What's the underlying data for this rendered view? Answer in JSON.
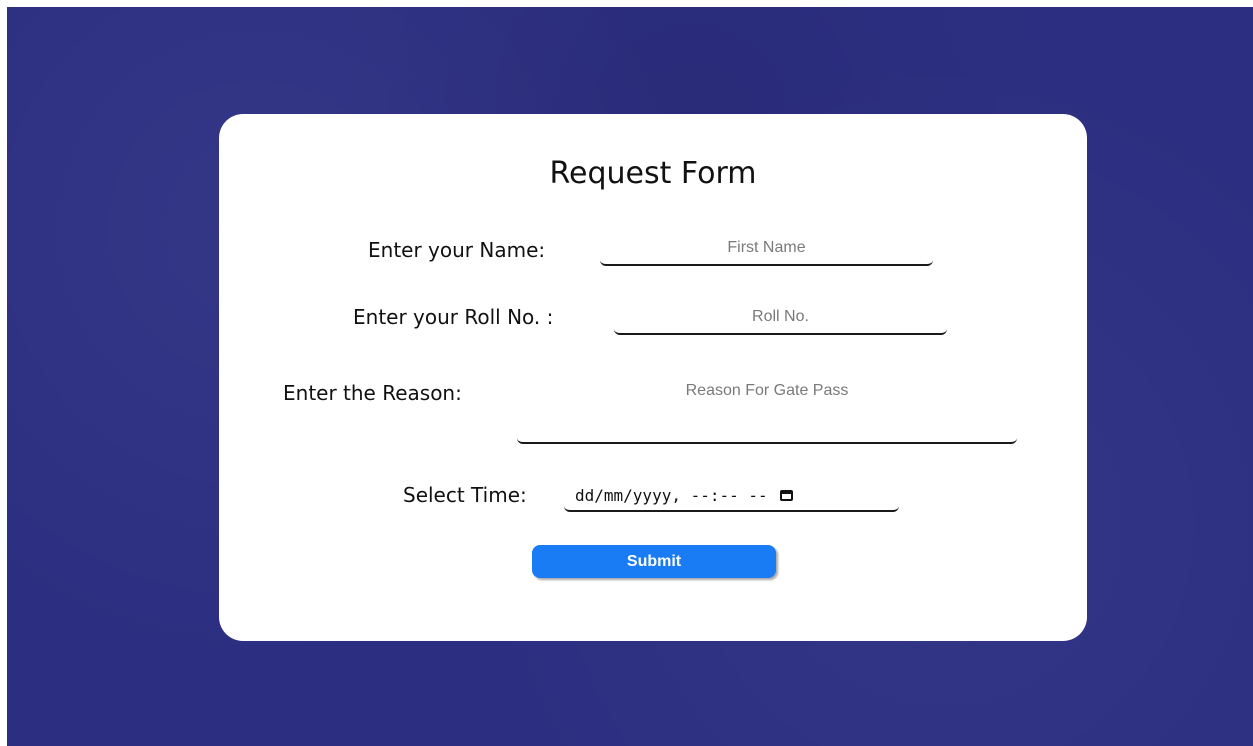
{
  "form": {
    "title": "Request Form",
    "name_label": "Enter your Name:",
    "name_placeholder": "First Name",
    "roll_label": "Enter your Roll No. :",
    "roll_placeholder": "Roll No.",
    "reason_label": "Enter the Reason:",
    "reason_placeholder": "Reason For Gate Pass",
    "time_label": "Select Time:",
    "time_value": "dd/mm/yyyy, --:-- --",
    "submit_label": "Submit"
  },
  "colors": {
    "background": "#2c2e81",
    "card": "#ffffff",
    "submit_button": "#1a7cf5"
  },
  "icons": {
    "calendar": "calendar-icon"
  }
}
